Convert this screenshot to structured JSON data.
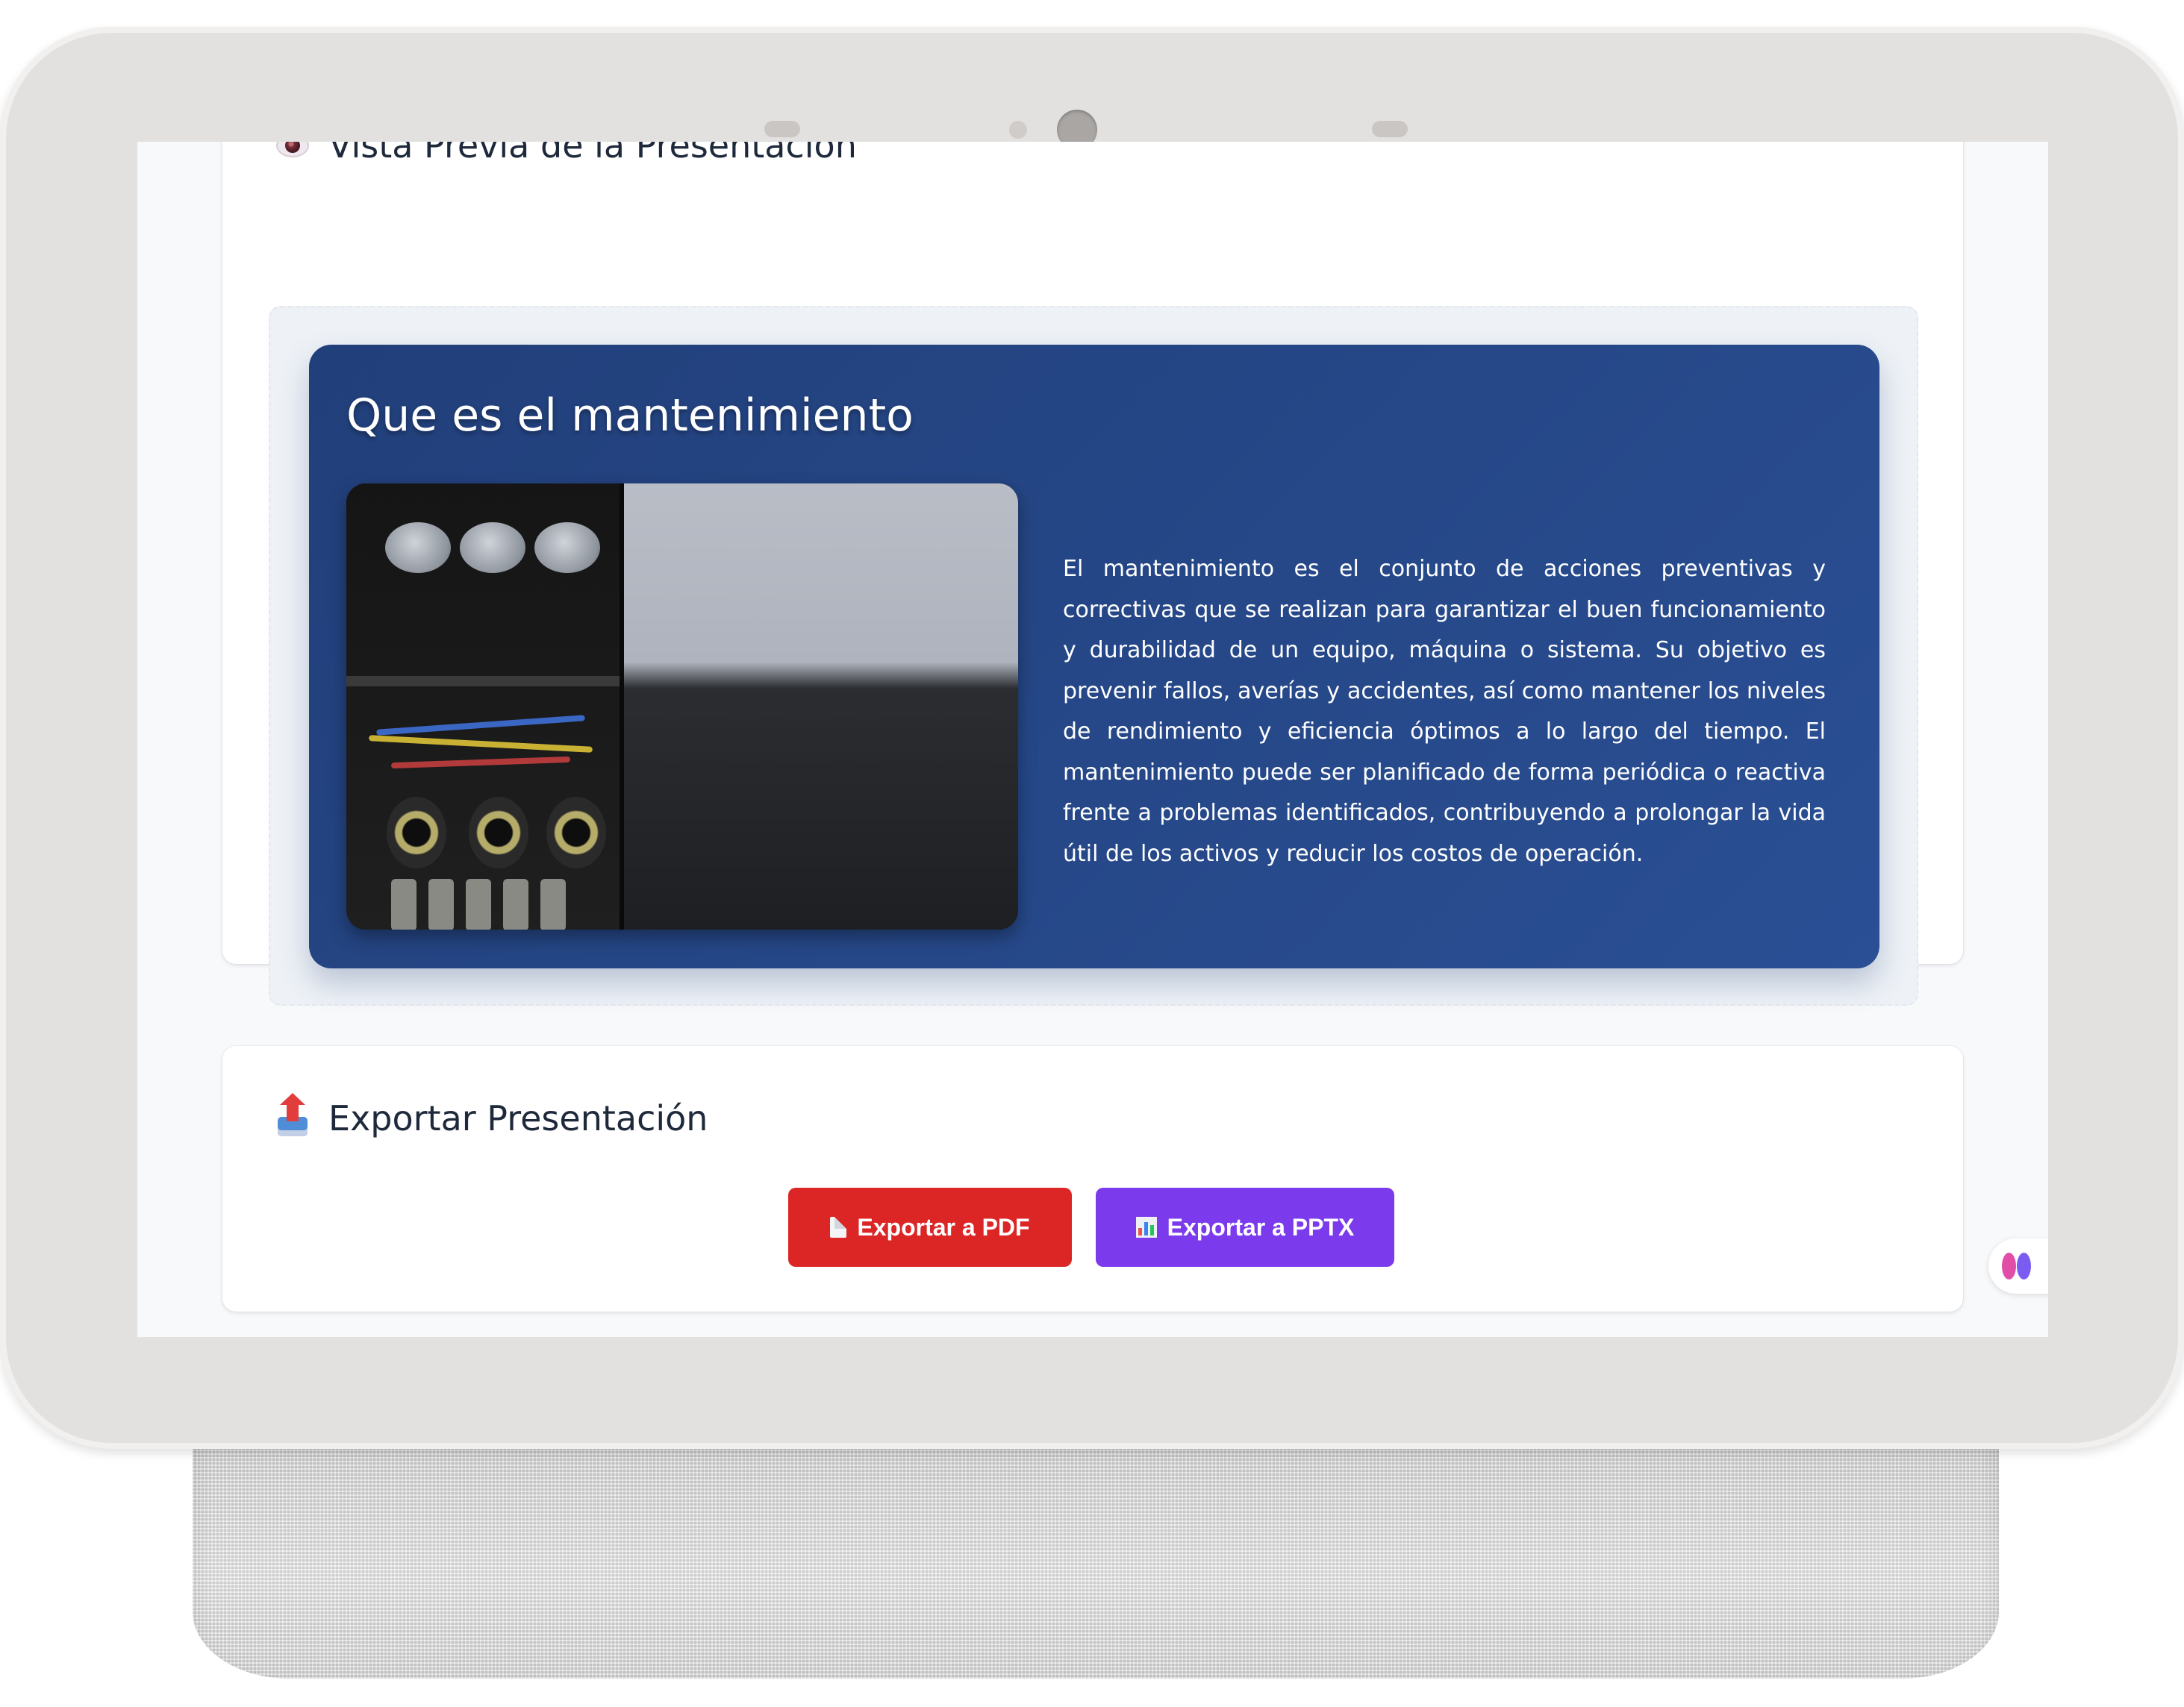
{
  "preview": {
    "section_title": "Vista Previa de la Presentación",
    "slide": {
      "title": "Que es el mantenimiento",
      "body": "El mantenimiento es el conjunto de acciones preventivas y correctivas que se realizan para garantizar el buen funcionamiento y durabilidad de un equipo, máquina o sistema. Su objetivo es prevenir fallos, averías y accidentes, así como mantener los niveles de rendimiento y eficiencia óptimos a lo largo del tiempo. El mantenimiento puede ser planificado de forma periódica o reactiva frente a problemas identificados, contribuyendo a prolongar la vida útil de los activos y reducir los costos de operación."
    }
  },
  "export": {
    "section_title": "Exportar Presentación",
    "pdf_label": "Exportar a PDF",
    "pptx_label": "Exportar a PPTX"
  },
  "icons": {
    "preview": "eye-icon",
    "export": "outbox-tray-icon",
    "pdf": "page-document-icon",
    "pptx": "bar-chart-icon",
    "assistant": "brain-icon"
  },
  "colors": {
    "slide_background": "#234281",
    "pdf_button": "#dc2626",
    "pptx_button": "#7c3aed",
    "page_background": "#f8f9fb"
  }
}
